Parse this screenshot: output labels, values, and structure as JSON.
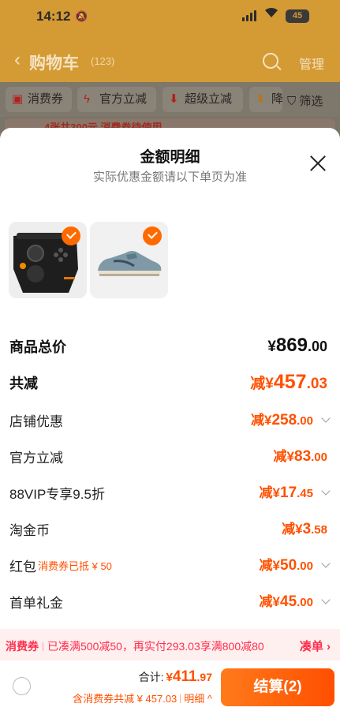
{
  "status_bar": {
    "time": "14:12",
    "battery": "45"
  },
  "background": {
    "title": "购物车",
    "count": "(123)",
    "manage": "管理",
    "chips": [
      "消费券",
      "官方立减",
      "超级立减",
      "降"
    ],
    "filter": "筛选",
    "promo": "4张共300元 消费券待使用"
  },
  "sheet": {
    "title": "金额明细",
    "subtitle": "实际优惠金额请以下单页为准",
    "products": [
      {
        "name": "gamepad-controller",
        "checked": true
      },
      {
        "name": "sneaker",
        "checked": true
      }
    ],
    "rows": {
      "total": {
        "label": "商品总价",
        "currency": "¥",
        "int": "869",
        "dec": ".00"
      },
      "discount": {
        "label": "共减",
        "prefix": "减",
        "currency": "¥",
        "int": "457",
        "dec": ".03"
      },
      "store": {
        "label": "店铺优惠",
        "prefix": "减",
        "currency": "¥",
        "int": "258",
        "dec": ".00"
      },
      "official": {
        "label": "官方立减",
        "prefix": "减",
        "currency": "¥",
        "int": "83",
        "dec": ".00"
      },
      "vip": {
        "label": "88VIP专享9.5折",
        "prefix": "减",
        "currency": "¥",
        "int": "17",
        "dec": ".45"
      },
      "coins": {
        "label": "淘金币",
        "prefix": "减",
        "currency": "¥",
        "int": "3",
        "dec": ".58"
      },
      "redpack": {
        "label": "红包",
        "note": "消费券已抵 ¥ 50",
        "prefix": "减",
        "currency": "¥",
        "int": "50",
        "dec": ".00"
      },
      "firstorder": {
        "label": "首单礼金",
        "prefix": "减",
        "currency": "¥",
        "int": "45",
        "dec": ".00"
      }
    },
    "banner": {
      "tag": "消费券",
      "text": "已凑满500减50，再实付293.03享满800减80",
      "action": "凑单 ›"
    },
    "footer": {
      "sum_label": "合计:",
      "sum_currency": "¥",
      "sum_int": "411",
      "sum_dec": ".97",
      "sub_text": "含消费券共减 ¥ 457.03",
      "details": "明细 ^",
      "checkout": "结算(2)"
    }
  }
}
